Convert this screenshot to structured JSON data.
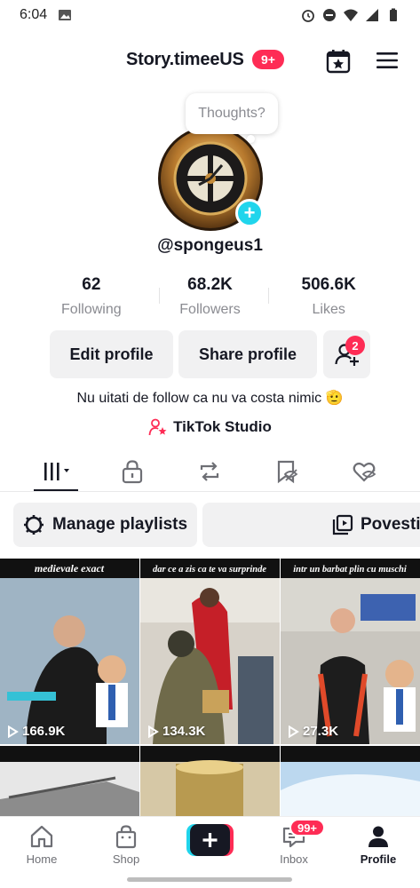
{
  "status_bar": {
    "time": "6:04"
  },
  "header": {
    "title": "Story.timeeUS",
    "badge": "9+"
  },
  "avatar": {
    "thoughts_placeholder": "Thoughts?"
  },
  "profile": {
    "handle": "@spongeus1",
    "bio": "Nu uitati de follow ca nu va costa nimic 🫡",
    "studio_label": "TikTok Studio"
  },
  "stats": [
    {
      "value": "62",
      "label": "Following"
    },
    {
      "value": "68.2K",
      "label": "Followers"
    },
    {
      "value": "506.6K",
      "label": "Likes"
    }
  ],
  "actions": {
    "edit_label": "Edit profile",
    "share_label": "Share profile",
    "add_friends_badge": "2"
  },
  "chips": {
    "playlists_label": "Manage playlists",
    "stories_label": "Povesti"
  },
  "videos": [
    {
      "views": "166.9K",
      "caption": "medievale exact"
    },
    {
      "views": "134.3K",
      "caption": "dar ce a zis ca te va surprinde"
    },
    {
      "views": "27.3K",
      "caption": "intr un barbat plin cu muschi"
    }
  ],
  "bottom_nav": {
    "home": "Home",
    "shop": "Shop",
    "inbox": "Inbox",
    "inbox_badge": "99+",
    "profile": "Profile"
  },
  "colors": {
    "accent": "#fe2c55",
    "cyan": "#20d5ec",
    "chip_bg": "#f1f1f2",
    "muted": "#8a8b91"
  }
}
